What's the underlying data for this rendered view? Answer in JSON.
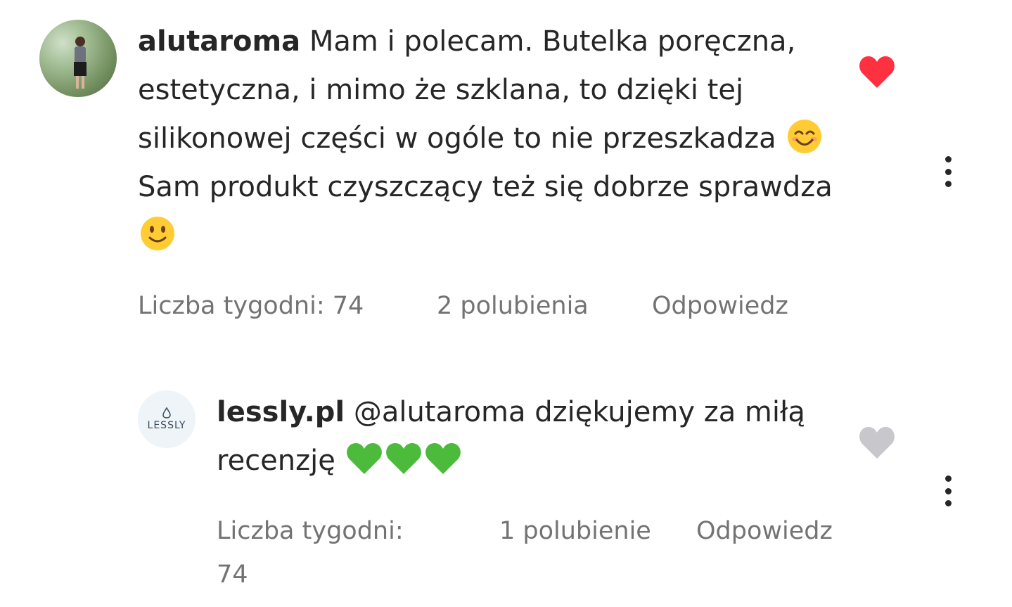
{
  "comments": [
    {
      "username": "alutaroma",
      "text_parts": [
        "Mam i polecam. Butelka poręczna, estetyczna, i mimo że szklana, to dzięki tej silikonowej części w ogóle to nie przeszkadza",
        "Sam produkt czyszczący też się dobrze sprawdza"
      ],
      "emojis": [
        "smiling-face-with-smiling-eyes",
        "slightly-smiling-face"
      ],
      "weeks": "Liczba tygodni: 74",
      "likes": "2 polubienia",
      "reply": "Odpowiedz",
      "liked": true,
      "like_color": "#ff3040"
    },
    {
      "username": "lessly.pl",
      "avatar_logo": "LESSLY",
      "text": "@alutaroma dziękujemy za miłą recenzję",
      "emojis": [
        "green-heart",
        "green-heart",
        "green-heart"
      ],
      "weeks": "Liczba tygodni: 74",
      "likes": "1 polubienie",
      "reply": "Odpowiedz",
      "liked": false,
      "like_color": "#c7c7cc"
    }
  ]
}
